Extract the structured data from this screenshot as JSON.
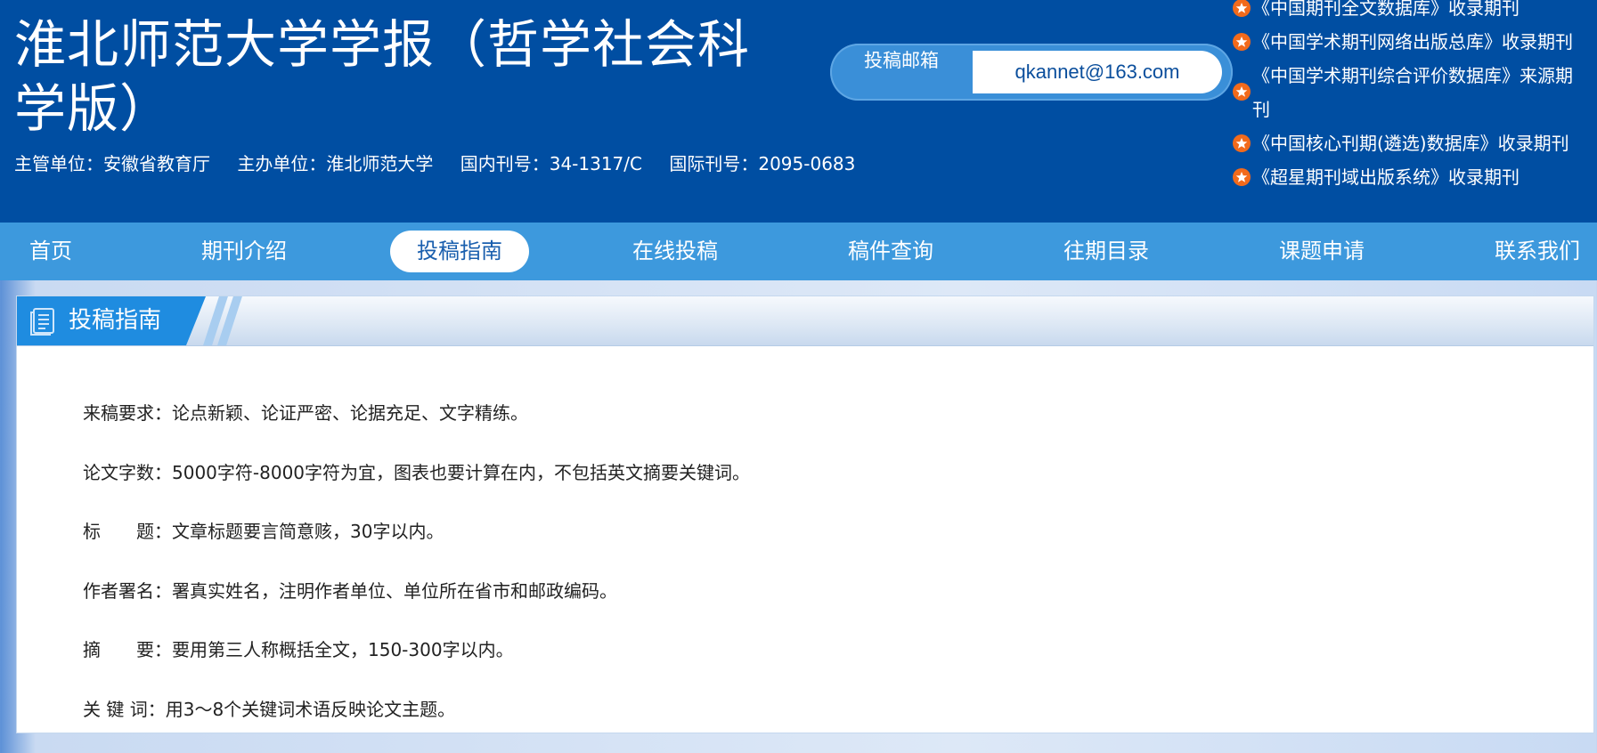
{
  "header": {
    "title": "淮北师范大学学报（哲学社会科学版）",
    "meta": [
      "主管单位：安徽省教育厅",
      "主办单位：淮北师范大学",
      "国内刊号：34-1317/C",
      "国际刊号：2095-0683"
    ],
    "submit_label": "投稿邮箱",
    "submit_email": "qkannet@163.com",
    "index_list": [
      "《中国期刊全文数据库》收录期刊",
      "《中国学术期刊网络出版总库》收录期刊",
      "《中国学术期刊综合评价数据库》来源期刊",
      "《中国核心刊期(遴选)数据库》收录期刊",
      "《超星期刊域出版系统》收录期刊"
    ]
  },
  "nav": {
    "items": [
      "首页",
      "期刊介绍",
      "投稿指南",
      "在线投稿",
      "稿件查询",
      "往期目录",
      "课题申请",
      "联系我们"
    ],
    "active_index": 2
  },
  "panel": {
    "title": "投稿指南",
    "guide": [
      {
        "label": "来稿要求：",
        "text": "论点新颖、论证严密、论据充足、文字精练。"
      },
      {
        "label": "论文字数：",
        "text": "5000字符-8000字符为宜，图表也要计算在内，不包括英文摘要关键词。"
      },
      {
        "label": "标　　题：",
        "text": "文章标题要言简意赅，30字以内。"
      },
      {
        "label": "作者署名：",
        "text": "署真实姓名，注明作者单位、单位所在省市和邮政编码。"
      },
      {
        "label": "摘　　要：",
        "text": "要用第三人称概括全文，150-300字以内。"
      },
      {
        "label": "关 键 词：",
        "text": "用3～8个关键词术语反映论文主题。"
      }
    ]
  },
  "colors": {
    "header_bg": "#004ea2",
    "nav_bg": "#3d99dd",
    "tab_bg": "#1f8ce0",
    "star": "#f26a1b"
  }
}
